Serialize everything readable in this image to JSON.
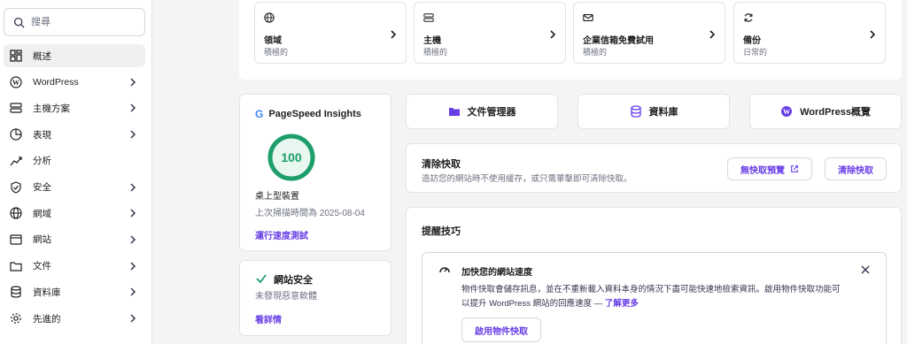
{
  "search": {
    "placeholder": "搜尋"
  },
  "sidebar": {
    "items": [
      {
        "label": "概述",
        "icon": "overview-icon",
        "active": true,
        "chevron": false
      },
      {
        "label": "WordPress",
        "icon": "wordpress-icon",
        "chevron": true
      },
      {
        "label": "主機方案",
        "icon": "server-icon",
        "chevron": true
      },
      {
        "label": "表現",
        "icon": "performance-icon",
        "chevron": true
      },
      {
        "label": "分析",
        "icon": "analytics-icon",
        "chevron": false
      },
      {
        "label": "安全",
        "icon": "shield-icon",
        "chevron": true
      },
      {
        "label": "網域",
        "icon": "globe-icon",
        "chevron": true
      },
      {
        "label": "網站",
        "icon": "website-icon",
        "chevron": true
      },
      {
        "label": "文件",
        "icon": "folder-icon",
        "chevron": true
      },
      {
        "label": "資料庫",
        "icon": "database-icon",
        "chevron": true
      },
      {
        "label": "先進的",
        "icon": "gear-icon",
        "chevron": true
      }
    ]
  },
  "quick_cards": [
    {
      "title": "領域",
      "subtitle": "積極的",
      "icon": "globe-icon"
    },
    {
      "title": "主機",
      "subtitle": "積極的",
      "icon": "server-icon"
    },
    {
      "title": "企業信箱免費試用",
      "subtitle": "積極的",
      "icon": "mail-icon"
    },
    {
      "title": "備份",
      "subtitle": "日常的",
      "icon": "backup-icon"
    }
  ],
  "pagespeed": {
    "title": "PageSpeed Insights",
    "score": "100",
    "score_fraction": 1.0,
    "device": "桌上型裝置",
    "last_scan": "上次掃描時間為 2025-08-04",
    "run_test": "運行速度測試"
  },
  "security": {
    "title": "網站安全",
    "status": "未發現惡意軟體",
    "details_link": "看詳情"
  },
  "tools": [
    {
      "label": "文件管理器",
      "icon": "folder-icon"
    },
    {
      "label": "資料庫",
      "icon": "database-icon"
    },
    {
      "label": "WordPress概覽",
      "icon": "wordpress-icon"
    }
  ],
  "cache": {
    "title": "清除快取",
    "description": "造訪您的網站時不使用緩存，或只需單擊即可清除快取。",
    "preview_button": "無快取預覽",
    "clear_button": "清除快取"
  },
  "tips": {
    "title": "提醒技巧",
    "tip_title": "加快您的網站速度",
    "tip_text_1": "物件快取會儲存訊息，並在不重新載入資料本身的情況下盡可能快速地檢索資訊。啟用物件快取功能可",
    "tip_text_2": "以提升 WordPress 網站的回應速度 —",
    "learn_more": "了解更多",
    "enable_button": "啟用物件快取"
  },
  "colors": {
    "accent": "#673de6",
    "success": "#1d9e6a"
  }
}
